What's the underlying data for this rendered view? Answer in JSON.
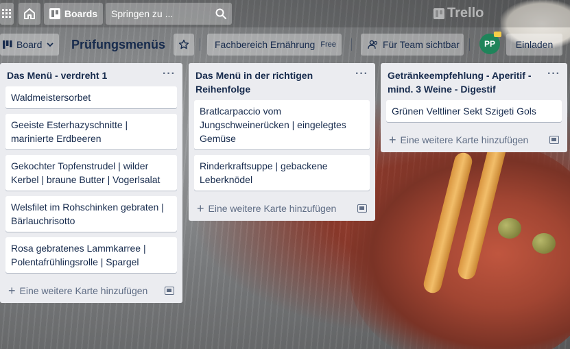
{
  "topbar": {
    "boards_label": "Boards",
    "search_placeholder": "Springen zu ...",
    "logo_text": "Trello"
  },
  "board": {
    "view_label": "Board",
    "title": "Prüfungsmenüs",
    "team_label": "Fachbereich Ernährung",
    "team_badge": "Free",
    "visibility_label": "Für Team sichtbar",
    "member_initials": "PP",
    "invite_label": "Einladen"
  },
  "add_card_label": "Eine weitere Karte hinzufügen",
  "lists": [
    {
      "title": "Das Menü - verdreht 1",
      "cards": [
        "Waldmeistersorbet",
        "Geeiste Esterhazyschnitte | marinierte Erdbeeren",
        "Gekochter Topfenstrudel | wilder Kerbel | braune Butter | Vogerlsalat",
        "Welsfilet im Rohschinken gebraten | Bärlauchrisotto",
        "Rosa gebratenes Lammkarree | Polentafrühlingsrolle | Spargel"
      ]
    },
    {
      "title": "Das Menü in der richtigen Reihenfolge",
      "cards": [
        "Bratlcarpaccio vom Jungschweinerücken | eingelegtes Gemüse",
        "Rinderkraftsuppe | gebackene Leberknödel"
      ]
    },
    {
      "title": "Getränkeempfehlung - Aperitif - mind. 3 Weine - Digestif",
      "cards": [
        "Grünen Veltliner Sekt Szigeti Gols"
      ]
    }
  ],
  "colors": {
    "list_bg": "#ebecf0",
    "text": "#172b4d",
    "muted": "#5e6c84",
    "avatar": "#1f845a"
  }
}
